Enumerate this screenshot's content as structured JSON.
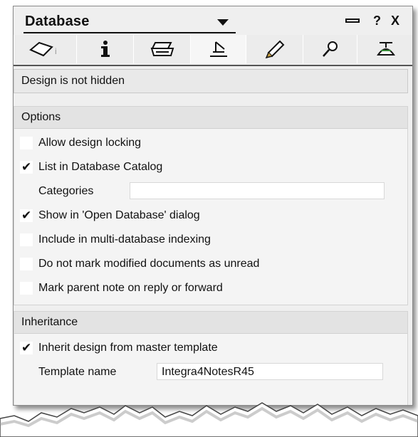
{
  "titlebar": {
    "title": "Database",
    "pin_icon": "pin-icon",
    "help_label": "?",
    "close_label": "X"
  },
  "tabs": [
    {
      "name": "info",
      "icon": "info-icon",
      "label": "i"
    },
    {
      "name": "basics",
      "icon": "eraser-icon"
    },
    {
      "name": "print",
      "icon": "printer-icon"
    },
    {
      "name": "design",
      "icon": "tsquare-icon",
      "active": true
    },
    {
      "name": "launch",
      "icon": "rocket-icon"
    },
    {
      "name": "search",
      "icon": "magnifier-icon"
    },
    {
      "name": "advanced",
      "icon": "propeller-hat-icon"
    }
  ],
  "design_status": "Design is not hidden",
  "options": {
    "header": "Options",
    "items": [
      {
        "label": "Allow design locking",
        "checked": false
      },
      {
        "label": "List in Database Catalog",
        "checked": true
      },
      {
        "label": "Show in 'Open Database' dialog",
        "checked": true
      },
      {
        "label": "Include in multi-database indexing",
        "checked": false
      },
      {
        "label": "Do not mark modified documents as unread",
        "checked": false
      },
      {
        "label": "Mark parent note on reply or forward",
        "checked": false
      }
    ],
    "categories_label": "Categories",
    "categories_value": ""
  },
  "inheritance": {
    "header": "Inheritance",
    "inherit_label": "Inherit design from master template",
    "inherit_checked": true,
    "template_label": "Template name",
    "template_value": "Integra4NotesR45"
  }
}
